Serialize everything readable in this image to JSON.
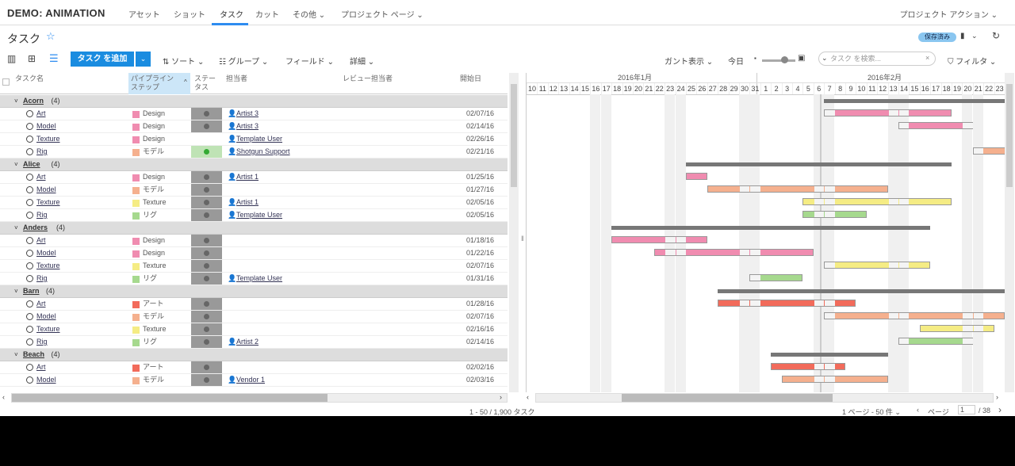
{
  "nav": {
    "brand": "DEMO: ANIMATION",
    "items": [
      "アセット",
      "ショット",
      "タスク",
      "カット",
      "その他 ⌄",
      "プロジェクト ページ ⌄"
    ],
    "project_actions": "プロジェクト アクション ⌄"
  },
  "page": {
    "title": "タスク",
    "save_status": "保存済み"
  },
  "toolbar": {
    "add": "タスク を追加",
    "sort": "ソート",
    "group": "グループ",
    "fields": "フィールド",
    "more": "詳細",
    "gantt": "ガント表示",
    "today": "今日",
    "search_placeholder": "タスク を検索...",
    "filter": "フィルタ"
  },
  "columns": {
    "name": "タスク名",
    "pipeline": "パイプライン ステップ",
    "status": "ステータス",
    "assigned": "担当者",
    "reviewer": "レビュー担当者",
    "start": "開始日"
  },
  "groups": [
    {
      "name": "Acorn",
      "count": "(4)",
      "rows": [
        {
          "entity": "Art",
          "color": "#f08cb0",
          "pipe": "Design",
          "status": "wait",
          "assignee": "Artist 3",
          "date": "02/07/16"
        },
        {
          "entity": "Model",
          "color": "#f08cb0",
          "pipe": "Design",
          "status": "wait",
          "assignee": "Artist 3",
          "date": "02/14/16"
        },
        {
          "entity": "Texture",
          "color": "#f08cb0",
          "pipe": "Design",
          "status": "none",
          "assignee": "Template User",
          "date": "02/26/16"
        },
        {
          "entity": "Rig",
          "color": "#f5b08e",
          "pipe": "モデル",
          "status": "green",
          "assignee": "Shotgun Support",
          "date": "02/21/16"
        }
      ]
    },
    {
      "name": "Alice",
      "count": "(4)",
      "rows": [
        {
          "entity": "Art",
          "color": "#f08cb0",
          "pipe": "Design",
          "status": "wait",
          "assignee": "Artist 1",
          "date": "01/25/16"
        },
        {
          "entity": "Model",
          "color": "#f5b08e",
          "pipe": "モデル",
          "status": "wait",
          "assignee": "",
          "date": "01/27/16"
        },
        {
          "entity": "Texture",
          "color": "#f5ec84",
          "pipe": "Texture",
          "status": "wait",
          "assignee": "Artist 1",
          "date": "02/05/16"
        },
        {
          "entity": "Rig",
          "color": "#a6d98e",
          "pipe": "リグ",
          "status": "wait",
          "assignee": "Template User",
          "date": "02/05/16"
        }
      ]
    },
    {
      "name": "Anders",
      "count": "(4)",
      "rows": [
        {
          "entity": "Art",
          "color": "#f08cb0",
          "pipe": "Design",
          "status": "wait",
          "assignee": "",
          "date": "01/18/16"
        },
        {
          "entity": "Model",
          "color": "#f08cb0",
          "pipe": "Design",
          "status": "wait",
          "assignee": "",
          "date": "01/22/16"
        },
        {
          "entity": "Texture",
          "color": "#f5ec84",
          "pipe": "Texture",
          "status": "wait",
          "assignee": "",
          "date": "02/07/16"
        },
        {
          "entity": "Rig",
          "color": "#a6d98e",
          "pipe": "リグ",
          "status": "wait",
          "assignee": "Template User",
          "date": "01/31/16"
        }
      ]
    },
    {
      "name": "Barn",
      "count": "(4)",
      "rows": [
        {
          "entity": "Art",
          "color": "#f26b5b",
          "pipe": "アート",
          "status": "wait",
          "assignee": "",
          "date": "01/28/16"
        },
        {
          "entity": "Model",
          "color": "#f5b08e",
          "pipe": "モデル",
          "status": "wait",
          "assignee": "",
          "date": "02/07/16"
        },
        {
          "entity": "Texture",
          "color": "#f5ec84",
          "pipe": "Texture",
          "status": "wait",
          "assignee": "",
          "date": "02/16/16"
        },
        {
          "entity": "Rig",
          "color": "#a6d98e",
          "pipe": "リグ",
          "status": "wait",
          "assignee": "Artist 2",
          "date": "02/14/16"
        }
      ]
    },
    {
      "name": "Beach",
      "count": "(4)",
      "rows": [
        {
          "entity": "Art",
          "color": "#f26b5b",
          "pipe": "アート",
          "status": "wait",
          "assignee": "",
          "date": "02/02/16"
        },
        {
          "entity": "Model",
          "color": "#f5b08e",
          "pipe": "モデル",
          "status": "wait",
          "assignee": "Vendor 1",
          "date": "02/03/16"
        }
      ]
    }
  ],
  "gantt": {
    "months": [
      "2016年1月",
      "2016年2月"
    ],
    "days": [
      "10",
      "11",
      "12",
      "13",
      "14",
      "15",
      "16",
      "17",
      "18",
      "19",
      "20",
      "21",
      "22",
      "23",
      "24",
      "25",
      "26",
      "27",
      "28",
      "29",
      "30",
      "31",
      "1",
      "2",
      "3",
      "4",
      "5",
      "6",
      "7",
      "8",
      "9",
      "10",
      "11",
      "12",
      "13",
      "14",
      "15",
      "16",
      "17",
      "18",
      "19",
      "20",
      "21",
      "22",
      "23"
    ]
  },
  "footer": {
    "range": "1 - 50 / 1,900 タスク",
    "page_size": "1 ページ - 50 件 ⌄",
    "page_label": "ページ",
    "page": "1",
    "pages": "/ 38"
  }
}
